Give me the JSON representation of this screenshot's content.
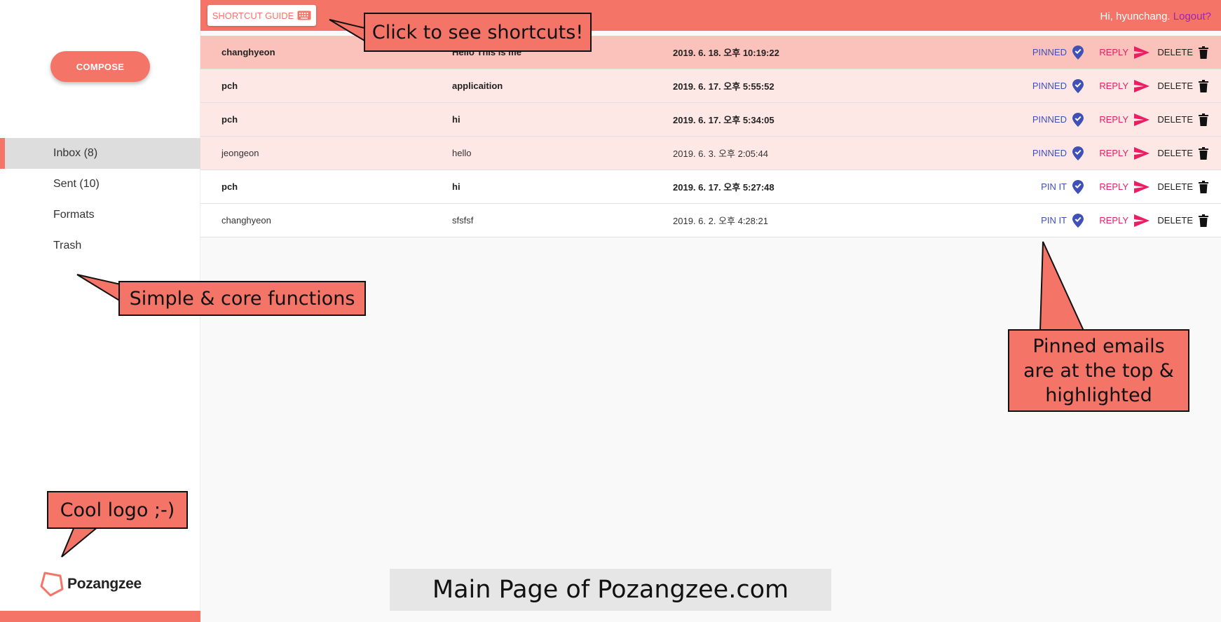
{
  "app": {
    "logo_text": "Pozangzee",
    "brand_color": "#f47467"
  },
  "sidebar": {
    "compose_label": "COMPOSE",
    "items": [
      {
        "label": "Inbox (8)",
        "active": true
      },
      {
        "label": "Sent (10)"
      },
      {
        "label": "Formats"
      },
      {
        "label": "Trash"
      }
    ]
  },
  "header": {
    "shortcut_label": "SHORTCUT GUIDE",
    "greeting": "Hi, hyunchang.",
    "logout_label": "Logout?"
  },
  "emails": [
    {
      "from": "changhyeon",
      "subject": "Hello This is me",
      "date": "2019. 6. 18. 오후 10:19:22",
      "pin_label": "PINNED",
      "unread": true,
      "pinned": true,
      "selected": true
    },
    {
      "from": "pch",
      "subject": "applicaition",
      "date": "2019. 6. 17. 오후 5:55:52",
      "pin_label": "PINNED",
      "unread": true,
      "pinned": true
    },
    {
      "from": "pch",
      "subject": "hi",
      "date": "2019. 6. 17. 오후 5:34:05",
      "pin_label": "PINNED",
      "unread": true,
      "pinned": true
    },
    {
      "from": "jeongeon",
      "subject": "hello",
      "date": "2019. 6. 3. 오후 2:05:44",
      "pin_label": "PINNED",
      "unread": false,
      "pinned": true
    },
    {
      "from": "pch",
      "subject": "hi",
      "date": "2019. 6. 17. 오후 5:27:48",
      "pin_label": "PIN IT",
      "unread": true,
      "pinned": false
    },
    {
      "from": "changhyeon",
      "subject": "sfsfsf",
      "date": "2019. 6. 2. 오후 4:28:21",
      "pin_label": "PIN IT",
      "unread": false,
      "pinned": false
    }
  ],
  "actions": {
    "reply_label": "REPLY",
    "delete_label": "DELETE"
  },
  "annotations": {
    "shortcuts": "Click to see shortcuts!",
    "core": "Simple & core functions",
    "pinned": "Pinned emails are at the top & highlighted",
    "logo": "Cool logo ;-)"
  },
  "caption": "Main Page of Pozangzee.com",
  "colors": {
    "pinned_selected_row": "#fbc2bb",
    "pinned_row": "#fde8e6",
    "pin_color": "#3f51b5",
    "reply_color": "#e91e63"
  },
  "icons": [
    "keyboard-icon",
    "pin-check-icon",
    "send-icon",
    "trash-icon",
    "logo-icon"
  ]
}
